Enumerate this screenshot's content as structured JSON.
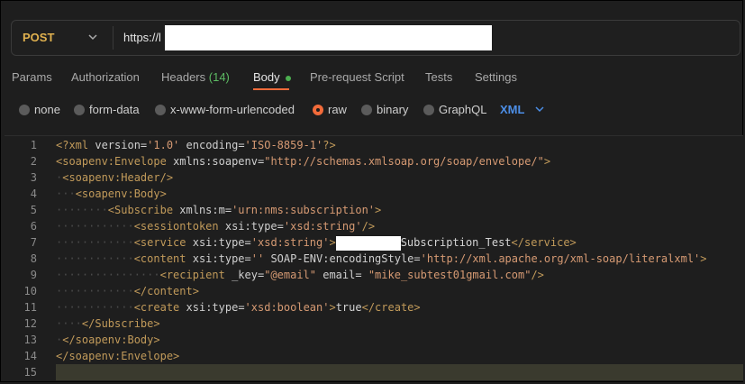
{
  "request": {
    "method": "POST",
    "url": "https://l"
  },
  "tabs": [
    {
      "label": "Params"
    },
    {
      "label": "Authorization"
    },
    {
      "label": "Headers",
      "count": "(14)"
    },
    {
      "label": "Body"
    },
    {
      "label": "Pre-request Script"
    },
    {
      "label": "Tests"
    },
    {
      "label": "Settings"
    }
  ],
  "body_modes": [
    {
      "label": "none"
    },
    {
      "label": "form-data"
    },
    {
      "label": "x-www-form-urlencoded"
    },
    {
      "label": "raw",
      "selected": true
    },
    {
      "label": "binary"
    },
    {
      "label": "GraphQL"
    }
  ],
  "format": "XML",
  "editor": {
    "line_numbers": [
      "1",
      "2",
      "3",
      "4",
      "5",
      "6",
      "7",
      "8",
      "9",
      "10",
      "11",
      "12",
      "13",
      "14",
      "15"
    ],
    "highlighted_line": "15"
  },
  "colors": {
    "accent": "#f26b3a",
    "method": "#e0b14f",
    "link": "#4c8ee6",
    "tag": "#c19a5a",
    "string": "#d69a73"
  }
}
